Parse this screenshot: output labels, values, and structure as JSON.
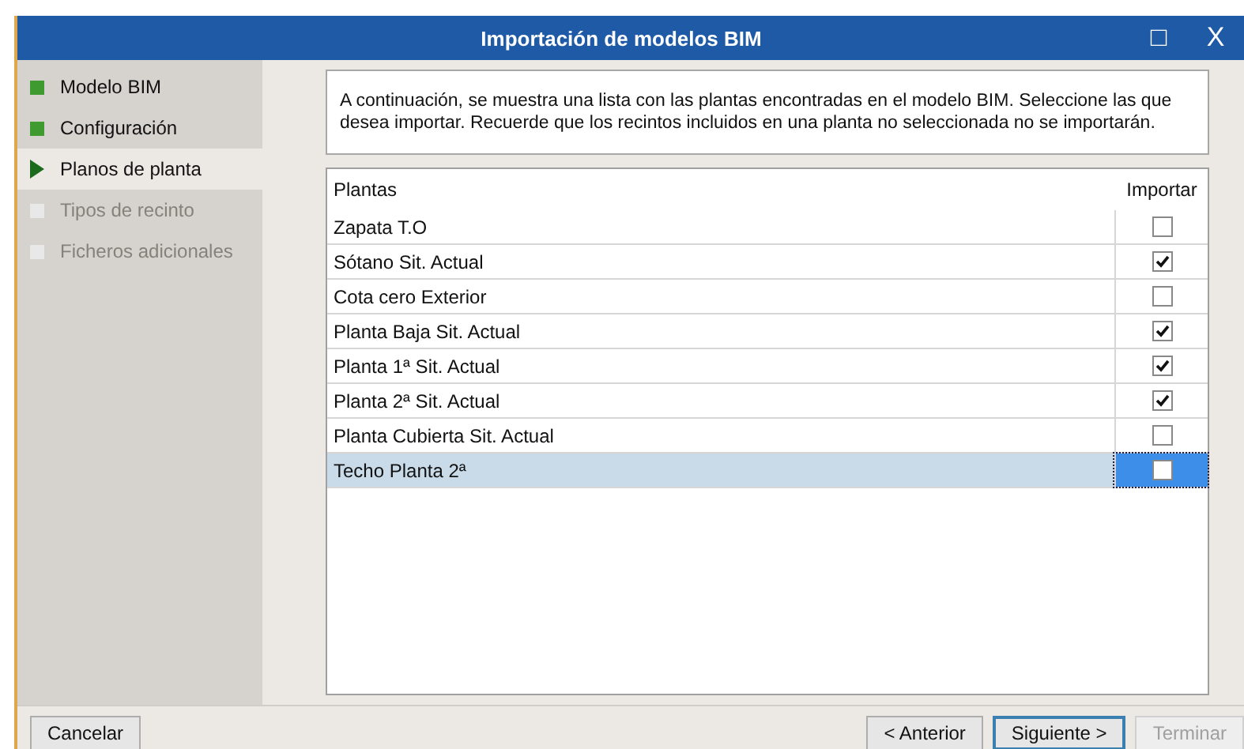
{
  "window": {
    "title": "Importación de modelos BIM",
    "controls": [
      "□",
      "X"
    ]
  },
  "steps": [
    {
      "label": "Modelo BIM",
      "kind": "done"
    },
    {
      "label": "Configuración",
      "kind": "done"
    },
    {
      "label": "Planos de planta",
      "kind": "current"
    },
    {
      "label": "Tipos de recinto",
      "kind": "pending"
    },
    {
      "label": "Ficheros adicionales",
      "kind": "pending"
    }
  ],
  "description": "A continuación, se muestra una lista con las plantas encontradas en el modelo BIM. Seleccione las que desea importar. Recuerde que los recintos incluidos en una planta no seleccionada no se importarán.",
  "table": {
    "columns": [
      "Plantas",
      "Importar"
    ],
    "rows": [
      {
        "name": "Zapata T.O",
        "checked": false,
        "selected": false
      },
      {
        "name": "Sótano Sit. Actual",
        "checked": true,
        "selected": false
      },
      {
        "name": "Cota cero Exterior",
        "checked": false,
        "selected": false
      },
      {
        "name": "Planta Baja Sit. Actual",
        "checked": true,
        "selected": false
      },
      {
        "name": "Planta 1ª Sit. Actual",
        "checked": true,
        "selected": false
      },
      {
        "name": "Planta 2ª Sit. Actual",
        "checked": true,
        "selected": false
      },
      {
        "name": "Planta Cubierta Sit. Actual",
        "checked": false,
        "selected": false
      },
      {
        "name": "Techo Planta 2ª",
        "checked": false,
        "selected": true
      }
    ]
  },
  "buttons": [
    {
      "label": "Cancelar",
      "kind": "left",
      "disabled": false
    },
    {
      "label": "< Anterior",
      "kind": "right",
      "disabled": false
    },
    {
      "label": "Siguiente >",
      "kind": "default",
      "disabled": false
    },
    {
      "label": "Terminar",
      "kind": "right",
      "disabled": true
    }
  ]
}
